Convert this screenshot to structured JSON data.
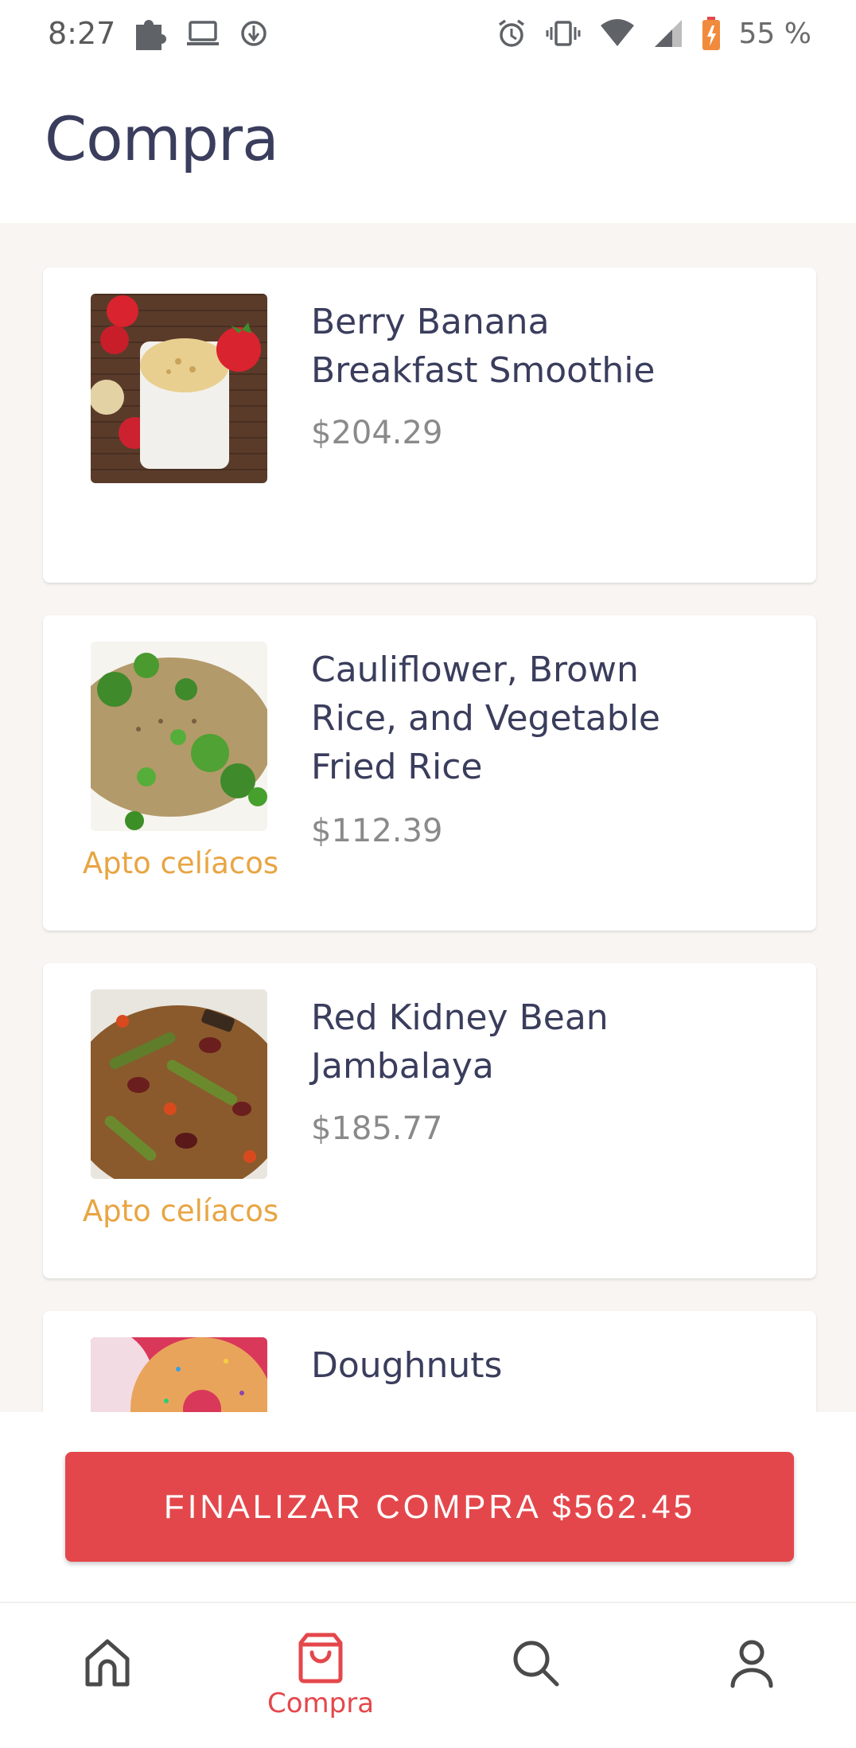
{
  "status_bar": {
    "time": "8:27",
    "battery_text": "55 %",
    "icons_left": [
      "puzzle-icon",
      "laptop-icon",
      "data-saver-icon"
    ],
    "icons_right": [
      "alarm-icon",
      "vibrate-icon",
      "wifi-icon",
      "signal-icon",
      "battery-icon"
    ]
  },
  "header": {
    "title": "Compra"
  },
  "items": [
    {
      "title": "Berry Banana Breakfast Smoothie",
      "price": "$204.29",
      "badge": ""
    },
    {
      "title": "Cauliflower, Brown Rice, and Vegetable Fried Rice",
      "price": "$112.39",
      "badge": "Apto celíacos"
    },
    {
      "title": "Red Kidney Bean Jambalaya",
      "price": "$185.77",
      "badge": "Apto celíacos"
    },
    {
      "title": "Doughnuts",
      "price": "",
      "badge": ""
    }
  ],
  "checkout": {
    "label": "FINALIZAR COMPRA $562.45"
  },
  "nav": {
    "items": [
      {
        "icon": "home-icon",
        "label": ""
      },
      {
        "icon": "shopping-bag-icon",
        "label": "Compra",
        "active": true
      },
      {
        "icon": "search-icon",
        "label": ""
      },
      {
        "icon": "profile-icon",
        "label": ""
      }
    ]
  },
  "colors": {
    "accent": "#e4474b",
    "badge": "#e8a543",
    "title_text": "#3a3d5c",
    "price_text": "#8a8a8a",
    "list_background": "#f8f5f2"
  }
}
